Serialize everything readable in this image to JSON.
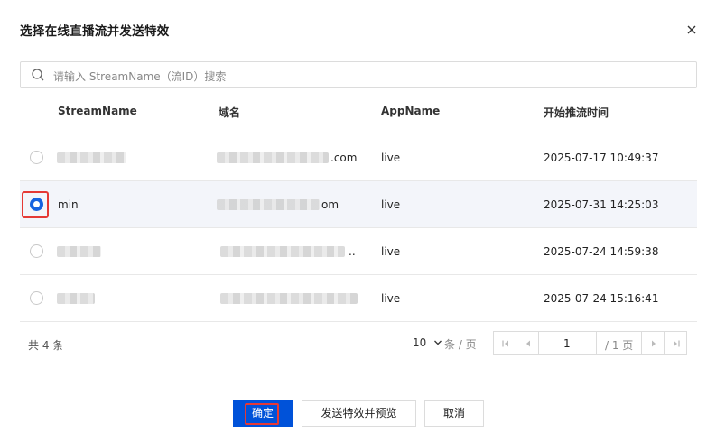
{
  "dialog": {
    "title": "选择在线直播流并发送特效",
    "search_placeholder": "请输入 StreamName（流ID）搜索"
  },
  "table": {
    "columns": [
      "StreamName",
      "域名",
      "AppName",
      "开始推流时间"
    ],
    "rows": [
      {
        "stream": "",
        "domain_suffix": ".com",
        "app": "live",
        "time": "2025-07-17 10:49:37",
        "selected": false
      },
      {
        "stream": "min",
        "domain_suffix": "om",
        "app": "live",
        "time": "2025-07-31 14:25:03",
        "selected": true
      },
      {
        "stream": "",
        "domain_suffix": "..",
        "app": "live",
        "time": "2025-07-24 14:59:38",
        "selected": false
      },
      {
        "stream": "",
        "domain_suffix": "",
        "app": "live",
        "time": "2025-07-24 15:16:41",
        "selected": false
      }
    ]
  },
  "pagination": {
    "total": "共 4 条",
    "page_size": "10",
    "per_page_label": "条 / 页",
    "current_page": "1",
    "total_pages": "/ 1 页"
  },
  "footer": {
    "confirm": "确定",
    "send_preview": "发送特效并预览",
    "cancel": "取消"
  },
  "colors": {
    "primary": "#0052d9",
    "highlight": "#e53935"
  }
}
